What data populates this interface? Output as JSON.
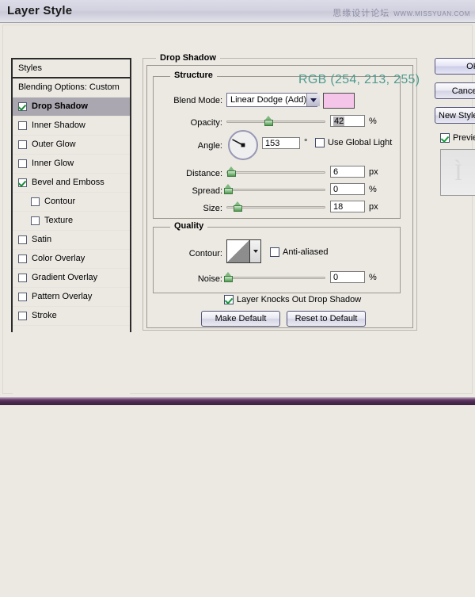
{
  "window": {
    "title": "Layer Style",
    "watermark_cn": "思缘设计论坛",
    "watermark_en": "WWW.MISSYUAN.COM"
  },
  "styles_panel": {
    "header": "Styles",
    "items": [
      {
        "label": "Blending Options: Custom",
        "checkbox": false,
        "checked": false,
        "selected": false,
        "indent": false
      },
      {
        "label": "Drop Shadow",
        "checkbox": true,
        "checked": true,
        "selected": true,
        "indent": false
      },
      {
        "label": "Inner Shadow",
        "checkbox": true,
        "checked": false,
        "selected": false,
        "indent": false
      },
      {
        "label": "Outer Glow",
        "checkbox": true,
        "checked": false,
        "selected": false,
        "indent": false
      },
      {
        "label": "Inner Glow",
        "checkbox": true,
        "checked": false,
        "selected": false,
        "indent": false
      },
      {
        "label": "Bevel and Emboss",
        "checkbox": true,
        "checked": true,
        "selected": false,
        "indent": false
      },
      {
        "label": "Contour",
        "checkbox": true,
        "checked": false,
        "selected": false,
        "indent": true
      },
      {
        "label": "Texture",
        "checkbox": true,
        "checked": false,
        "selected": false,
        "indent": true
      },
      {
        "label": "Satin",
        "checkbox": true,
        "checked": false,
        "selected": false,
        "indent": false
      },
      {
        "label": "Color Overlay",
        "checkbox": true,
        "checked": false,
        "selected": false,
        "indent": false
      },
      {
        "label": "Gradient Overlay",
        "checkbox": true,
        "checked": false,
        "selected": false,
        "indent": false
      },
      {
        "label": "Pattern Overlay",
        "checkbox": true,
        "checked": false,
        "selected": false,
        "indent": false
      },
      {
        "label": "Stroke",
        "checkbox": true,
        "checked": false,
        "selected": false,
        "indent": false
      }
    ]
  },
  "drop_shadow": {
    "group_label": "Drop Shadow",
    "structure": {
      "group_label": "Structure",
      "blend_mode_label": "Blend Mode:",
      "blend_mode_value": "Linear Dodge (Add)",
      "color_swatch": "#f4c4e9",
      "rgb_annotation": "RGB (254, 213, 255)",
      "rgb_annotation_color": "#4e9b8f",
      "opacity_label": "Opacity:",
      "opacity_value": "42",
      "opacity_unit": "%",
      "angle_label": "Angle:",
      "angle_value": "153",
      "angle_unit": "°",
      "use_global_light_label": "Use Global Light",
      "use_global_light_checked": false,
      "distance_label": "Distance:",
      "distance_value": "6",
      "distance_unit": "px",
      "spread_label": "Spread:",
      "spread_value": "0",
      "spread_unit": "%",
      "size_label": "Size:",
      "size_value": "18",
      "size_unit": "px"
    },
    "quality": {
      "group_label": "Quality",
      "contour_label": "Contour:",
      "anti_aliased_label": "Anti-aliased",
      "anti_aliased_checked": false,
      "noise_label": "Noise:",
      "noise_value": "0",
      "noise_unit": "%"
    },
    "knockout_label": "Layer Knocks Out Drop Shadow",
    "knockout_checked": true,
    "make_default_label": "Make Default",
    "reset_default_label": "Reset to Default"
  },
  "right_buttons": {
    "ok_label": "OK",
    "cancel_label": "Cancel",
    "new_style_label": "New Style...",
    "preview_label": "Preview",
    "preview_checked": true
  }
}
